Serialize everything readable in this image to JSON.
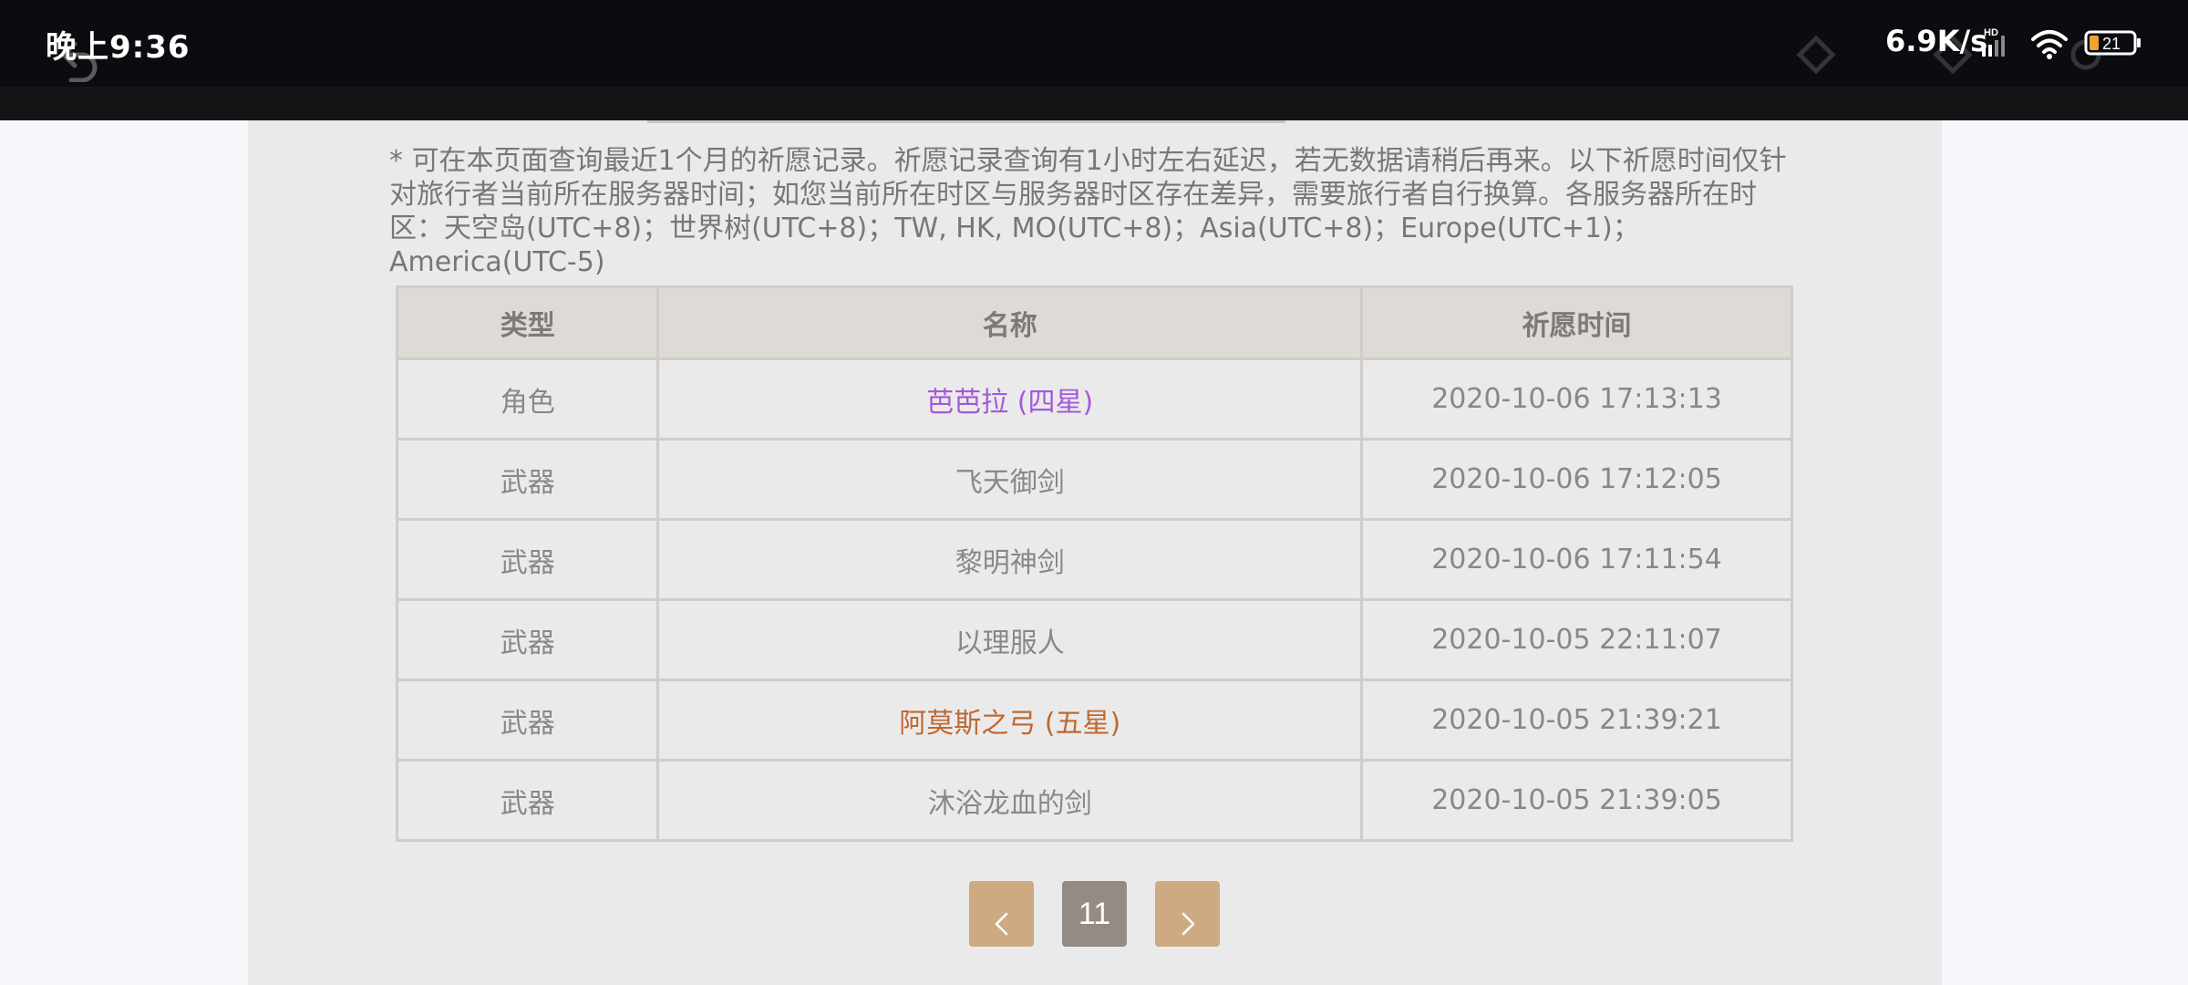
{
  "status_bar": {
    "time": "晚上9:36",
    "net_speed": "6.9K/s",
    "signal_label": "HD",
    "battery_level": "21",
    "icons": [
      "back-ghost-icon",
      "signal-icon",
      "wifi-icon",
      "battery-icon"
    ]
  },
  "notice": "* 可在本页面查询最近1个月的祈愿记录。祈愿记录查询有1小时左右延迟，若无数据请稍后再来。以下祈愿时间仅针对旅行者当前所在服务器时间；如您当前所在时区与服务器时区存在差异，需要旅行者自行换算。各服务器所在时区：天空岛(UTC+8)；世界树(UTC+8)；TW, HK, MO(UTC+8)；Asia(UTC+8)；Europe(UTC+1)；America(UTC-5)",
  "table": {
    "headers": {
      "type": "类型",
      "name": "名称",
      "time": "祈愿时间"
    },
    "rows": [
      {
        "type": "角色",
        "name": "芭芭拉 (四星)",
        "time": "2020-10-06 17:13:13",
        "name_color": "#a25ad9"
      },
      {
        "type": "武器",
        "name": "飞天御剑",
        "time": "2020-10-06 17:12:05",
        "name_color": "#8a8785"
      },
      {
        "type": "武器",
        "name": "黎明神剑",
        "time": "2020-10-06 17:11:54",
        "name_color": "#8a8785"
      },
      {
        "type": "武器",
        "name": "以理服人",
        "time": "2020-10-05 22:11:07",
        "name_color": "#8a8785"
      },
      {
        "type": "武器",
        "name": "阿莫斯之弓 (五星)",
        "time": "2020-10-05 21:39:21",
        "name_color": "#bd6932"
      },
      {
        "type": "武器",
        "name": "沐浴龙血的剑",
        "time": "2020-10-05 21:39:05",
        "name_color": "#8a8785"
      }
    ]
  },
  "pagination": {
    "current_page": "11",
    "prev_icon": "chevron-left-icon",
    "next_icon": "chevron-right-icon"
  }
}
